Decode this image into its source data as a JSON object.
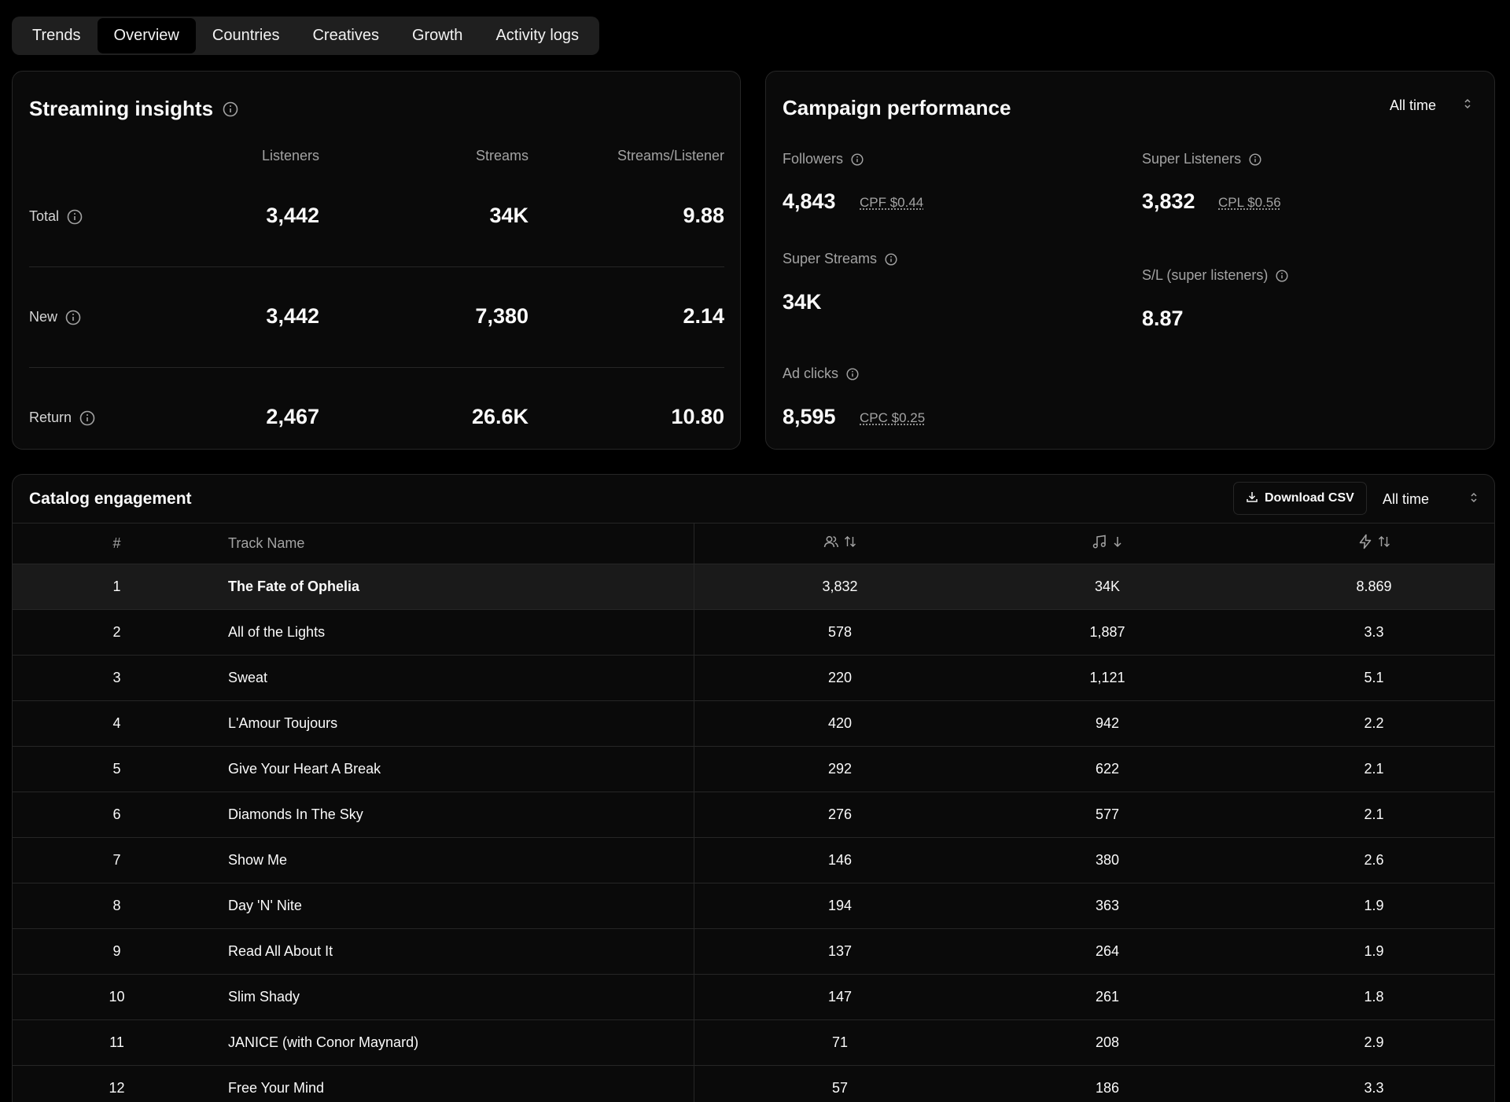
{
  "tabs": [
    "Trends",
    "Overview",
    "Countries",
    "Creatives",
    "Growth",
    "Activity logs"
  ],
  "active_tab": "Overview",
  "streaming": {
    "title": "Streaming insights",
    "headers": [
      "Listeners",
      "Streams",
      "Streams/Listener"
    ],
    "rows": [
      {
        "label": "Total",
        "listeners": "3,442",
        "streams": "34K",
        "ratio": "9.88"
      },
      {
        "label": "New",
        "listeners": "3,442",
        "streams": "7,380",
        "ratio": "2.14"
      },
      {
        "label": "Return",
        "listeners": "2,467",
        "streams": "26.6K",
        "ratio": "10.80"
      }
    ]
  },
  "campaign": {
    "title": "Campaign performance",
    "range": "All time",
    "followers": {
      "label": "Followers",
      "value": "4,843",
      "sub": "CPF $0.44"
    },
    "super_listeners": {
      "label": "Super Listeners",
      "value": "3,832",
      "sub": "CPL $0.56"
    },
    "super_streams": {
      "label": "Super Streams",
      "value": "34K"
    },
    "sl_ratio": {
      "label": "S/L (super listeners)",
      "value": "8.87"
    },
    "ad_clicks": {
      "label": "Ad clicks",
      "value": "8,595",
      "sub": "CPC $0.25"
    }
  },
  "catalog": {
    "title": "Catalog engagement",
    "download_label": "Download CSV",
    "range": "All time",
    "headers": {
      "num": "#",
      "name": "Track Name"
    },
    "icons": {
      "col_a": "users-icon",
      "col_b": "music-note-icon",
      "col_c": "lightning-icon"
    },
    "rows": [
      {
        "num": "1",
        "name": "The Fate of Ophelia",
        "a": "3,832",
        "b": "34K",
        "c": "8.869"
      },
      {
        "num": "2",
        "name": "All of the Lights",
        "a": "578",
        "b": "1,887",
        "c": "3.3"
      },
      {
        "num": "3",
        "name": "Sweat",
        "a": "220",
        "b": "1,121",
        "c": "5.1"
      },
      {
        "num": "4",
        "name": "L'Amour Toujours",
        "a": "420",
        "b": "942",
        "c": "2.2"
      },
      {
        "num": "5",
        "name": "Give Your Heart A Break",
        "a": "292",
        "b": "622",
        "c": "2.1"
      },
      {
        "num": "6",
        "name": "Diamonds In The Sky",
        "a": "276",
        "b": "577",
        "c": "2.1"
      },
      {
        "num": "7",
        "name": "Show Me",
        "a": "146",
        "b": "380",
        "c": "2.6"
      },
      {
        "num": "8",
        "name": "Day 'N' Nite",
        "a": "194",
        "b": "363",
        "c": "1.9"
      },
      {
        "num": "9",
        "name": "Read All About It",
        "a": "137",
        "b": "264",
        "c": "1.9"
      },
      {
        "num": "10",
        "name": "Slim Shady",
        "a": "147",
        "b": "261",
        "c": "1.8"
      },
      {
        "num": "11",
        "name": "JANICE (with Conor Maynard)",
        "a": "71",
        "b": "208",
        "c": "2.9"
      },
      {
        "num": "12",
        "name": "Free Your Mind",
        "a": "57",
        "b": "186",
        "c": "3.3"
      }
    ]
  }
}
